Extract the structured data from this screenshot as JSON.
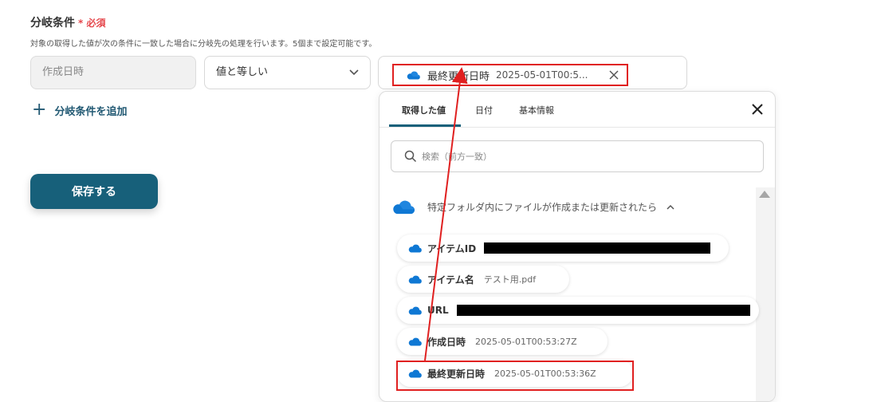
{
  "section": {
    "title": "分岐条件",
    "required_mark": "* 必須",
    "description": "対象の取得した値が次の条件に一致した場合に分岐先の処理を行います。5個まで設定可能です。"
  },
  "condition": {
    "field": "作成日時",
    "operator": "値と等しい",
    "value_name": "最終更新日時",
    "value_preview": "2025-05-01T00:5..."
  },
  "add_condition_label": "分岐条件を追加",
  "save_label": "保存する",
  "panel": {
    "tabs": [
      "取得した値",
      "日付",
      "基本情報"
    ],
    "search_placeholder": "検索（前方一致）",
    "group_title": "特定フォルダ内にファイルが作成または更新されたら",
    "items": [
      {
        "name": "アイテムID",
        "value": ""
      },
      {
        "name": "アイテム名",
        "value": "テスト用.pdf"
      },
      {
        "name": "URL",
        "value": ""
      },
      {
        "name": "作成日時",
        "value": "2025-05-01T00:53:27Z"
      },
      {
        "name": "最終更新日時",
        "value": "2025-05-01T00:53:36Z"
      }
    ]
  },
  "colors": {
    "accent": "#17607a",
    "highlight": "#e02020",
    "cloud": "#0f78d4"
  },
  "icons": {
    "cloud": "onedrive-cloud-icon",
    "search": "search-icon",
    "close": "close-icon",
    "chevron": "chevron-down-icon"
  }
}
